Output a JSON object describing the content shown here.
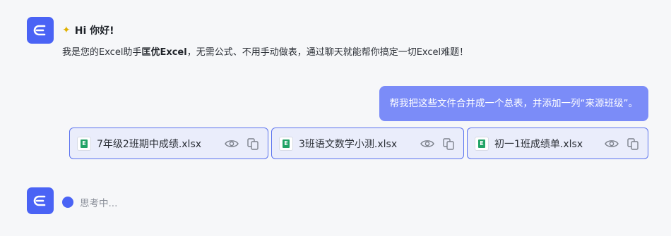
{
  "assistant": {
    "greeting": "Hi 你好!",
    "intro_before": "我是您的Excel助手",
    "intro_brand": "匡优Excel",
    "intro_after": "，无需公式、不用手动做表，通过聊天就能帮你搞定一切Excel难题！",
    "thinking_text": "思考中..."
  },
  "user_message": {
    "text": "帮我把这些文件合并成一个总表，并添加一列“来源班级”。"
  },
  "attachments": [
    {
      "name": "7年级2班期中成绩.xlsx",
      "icon": "excel-file-icon"
    },
    {
      "name": "3班语文数学小测.xlsx",
      "icon": "excel-file-icon"
    },
    {
      "name": "初一1班成绩单.xlsx",
      "icon": "excel-file-icon"
    }
  ],
  "colors": {
    "brand": "#4a63f5",
    "user_bubble": "#7b8cf8",
    "attachment_border": "#5b73ef",
    "attachment_bg": "#eaedfb"
  }
}
